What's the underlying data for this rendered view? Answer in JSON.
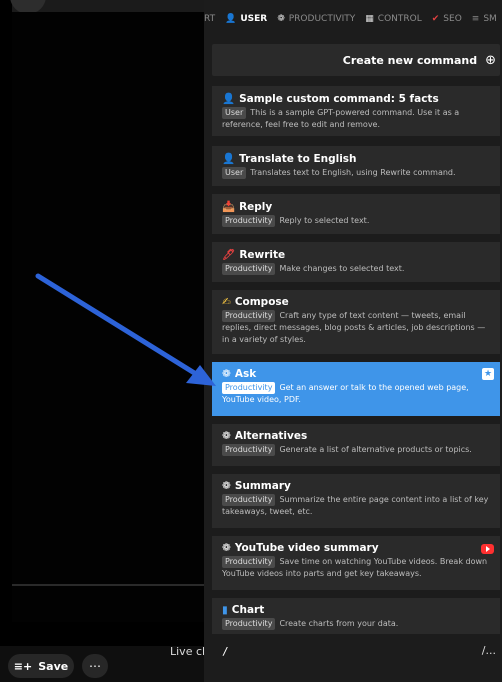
{
  "video": {
    "live_chat_label": "Live cha",
    "save_label": "Save",
    "save_icon": "≡+",
    "more_label": "⋯"
  },
  "tabs": [
    {
      "label": "RT",
      "icon": ""
    },
    {
      "label": "USER",
      "icon": "👤",
      "active": true
    },
    {
      "label": "PRODUCTIVITY",
      "icon": "❁"
    },
    {
      "label": "CONTROL",
      "icon": "▦"
    },
    {
      "label": "SEO",
      "icon": "✔"
    },
    {
      "label": "SM",
      "icon": "≡"
    }
  ],
  "create": {
    "label": "Create new command",
    "icon": "⊕"
  },
  "cards": [
    {
      "icon": "👤",
      "title": "Sample custom command: 5 facts",
      "badge": "User",
      "desc": "This is a sample GPT-powered command. Use it as a reference, feel free to edit and remove."
    },
    {
      "icon": "👤",
      "title": "Translate to English",
      "badge": "User",
      "desc": "Translates text to English, using Rewrite command."
    },
    {
      "icon": "📥",
      "title": "Reply",
      "badge": "Productivity",
      "desc": "Reply to selected text."
    },
    {
      "icon": "🖊",
      "title": "Rewrite",
      "badge": "Productivity",
      "desc": "Make changes to selected text."
    },
    {
      "icon": "✍",
      "title": "Compose",
      "badge": "Productivity",
      "desc": "Craft any type of text content — tweets, email replies, direct messages, blog posts & articles, job descriptions — in a variety of styles."
    },
    {
      "icon": "❁",
      "title": "Ask",
      "badge": "Productivity",
      "desc": "Get an answer or talk to the opened web page, YouTube video, PDF.",
      "highlight": true,
      "star": "★"
    },
    {
      "icon": "❁",
      "title": "Alternatives",
      "badge": "Productivity",
      "desc": "Generate a list of alternative products or topics."
    },
    {
      "icon": "❁",
      "title": "Summary",
      "badge": "Productivity",
      "desc": "Summarize the entire page content into a list of key takeaways, tweet, etc."
    },
    {
      "icon": "❁",
      "title": "YouTube video summary",
      "badge": "Productivity",
      "desc": "Save time on watching YouTube videos. Break down YouTube videos into parts and get key takeaways.",
      "yt": true
    },
    {
      "icon": "▮",
      "title": "Chart",
      "badge": "Productivity",
      "desc": "Create charts from your data."
    }
  ],
  "input": {
    "value": "/",
    "hint": "/..."
  },
  "colors": {
    "accent": "#3f95e9",
    "arrow": "#2d63d8",
    "panel": "#1c1c1c",
    "card": "#2a2a2a"
  }
}
